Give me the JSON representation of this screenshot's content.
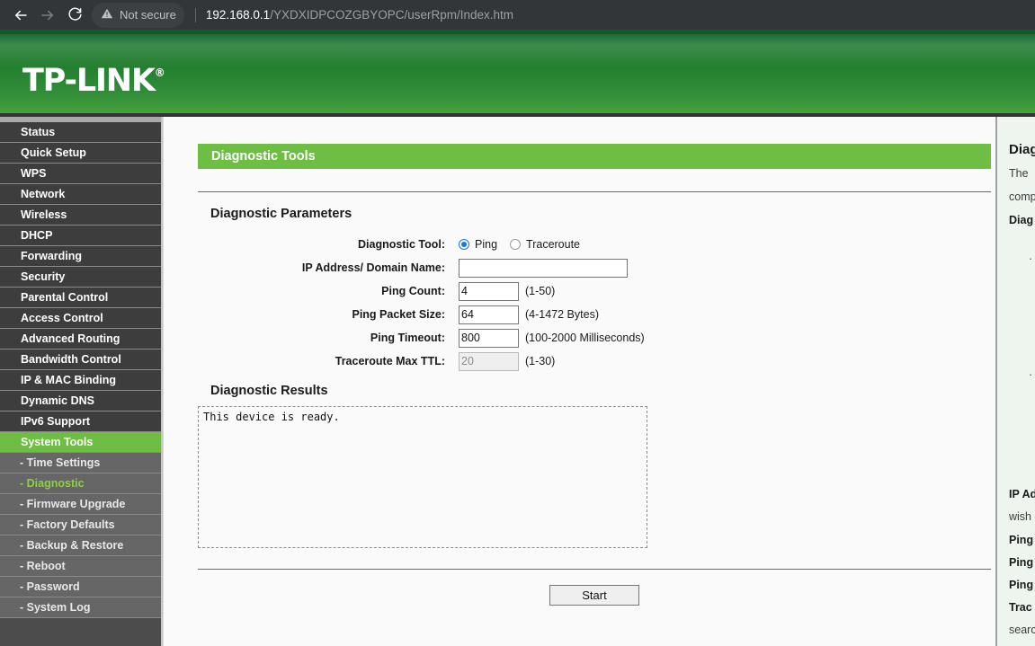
{
  "browser": {
    "back_icon": "back-arrow-icon",
    "forward_icon": "forward-arrow-icon",
    "reload_icon": "reload-icon",
    "warning_icon": "warning-triangle-icon",
    "security_text": "Not secure",
    "url_host": "192.168.0.1",
    "url_path": "/YXDXIDPCOZGBYOPC/userRpm/Index.htm"
  },
  "brand": {
    "name": "TP-LINK",
    "registered_mark": "®",
    "banner_color": "#2e8b37"
  },
  "sidebar": {
    "items": [
      {
        "label": "Status",
        "type": "top",
        "state": "normal"
      },
      {
        "label": "Quick Setup",
        "type": "top",
        "state": "normal"
      },
      {
        "label": "WPS",
        "type": "top",
        "state": "normal"
      },
      {
        "label": "Network",
        "type": "top",
        "state": "normal"
      },
      {
        "label": "Wireless",
        "type": "top",
        "state": "normal"
      },
      {
        "label": "DHCP",
        "type": "top",
        "state": "normal"
      },
      {
        "label": "Forwarding",
        "type": "top",
        "state": "normal"
      },
      {
        "label": "Security",
        "type": "top",
        "state": "normal"
      },
      {
        "label": "Parental Control",
        "type": "top",
        "state": "normal"
      },
      {
        "label": "Access Control",
        "type": "top",
        "state": "normal"
      },
      {
        "label": "Advanced Routing",
        "type": "top",
        "state": "normal"
      },
      {
        "label": "Bandwidth Control",
        "type": "top",
        "state": "normal"
      },
      {
        "label": "IP & MAC Binding",
        "type": "top",
        "state": "normal"
      },
      {
        "label": "Dynamic DNS",
        "type": "top",
        "state": "normal"
      },
      {
        "label": "IPv6 Support",
        "type": "top",
        "state": "normal"
      },
      {
        "label": "System Tools",
        "type": "top",
        "state": "active"
      },
      {
        "label": "- Time Settings",
        "type": "sub",
        "state": "normal"
      },
      {
        "label": "- Diagnostic",
        "type": "sub",
        "state": "current"
      },
      {
        "label": "- Firmware Upgrade",
        "type": "sub",
        "state": "normal"
      },
      {
        "label": "- Factory Defaults",
        "type": "sub",
        "state": "normal"
      },
      {
        "label": "- Backup & Restore",
        "type": "sub",
        "state": "normal"
      },
      {
        "label": "- Reboot",
        "type": "sub",
        "state": "normal"
      },
      {
        "label": "- Password",
        "type": "sub",
        "state": "normal"
      },
      {
        "label": "- System Log",
        "type": "sub",
        "state": "normal"
      }
    ],
    "accent_color": "#6ebe44"
  },
  "main": {
    "title": "Diagnostic Tools",
    "parameters_heading": "Diagnostic Parameters",
    "fields": {
      "tool": {
        "label": "Diagnostic Tool:",
        "options": [
          {
            "label": "Ping",
            "selected": true
          },
          {
            "label": "Traceroute",
            "selected": false
          }
        ]
      },
      "address": {
        "label": "IP Address/ Domain Name:",
        "value": "",
        "placeholder": ""
      },
      "ping_count": {
        "label": "Ping Count:",
        "value": "4",
        "hint": "(1-50)"
      },
      "ping_packet_size": {
        "label": "Ping Packet Size:",
        "value": "64",
        "hint": "(4-1472 Bytes)"
      },
      "ping_timeout": {
        "label": "Ping Timeout:",
        "value": "800",
        "hint": "(100-2000 Milliseconds)"
      },
      "traceroute_max_ttl": {
        "label": "Traceroute Max TTL:",
        "value": "20",
        "hint": "(1-30)",
        "disabled": true
      }
    },
    "results_heading": "Diagnostic Results",
    "results_text": "This device is ready.",
    "start_button": "Start"
  },
  "help": {
    "title": "Diag",
    "intro_line1": "The",
    "intro_line2": "comp",
    "subtitle": "Diag",
    "bullet1": "·",
    "bullet2": "·",
    "term1_bold": "IP Ad",
    "term1_text": "wish",
    "term2_bold": "Ping",
    "term3_bold": "Ping",
    "term4_bold": "Ping",
    "term5_bold": "Trac",
    "term5_text": "searc"
  }
}
